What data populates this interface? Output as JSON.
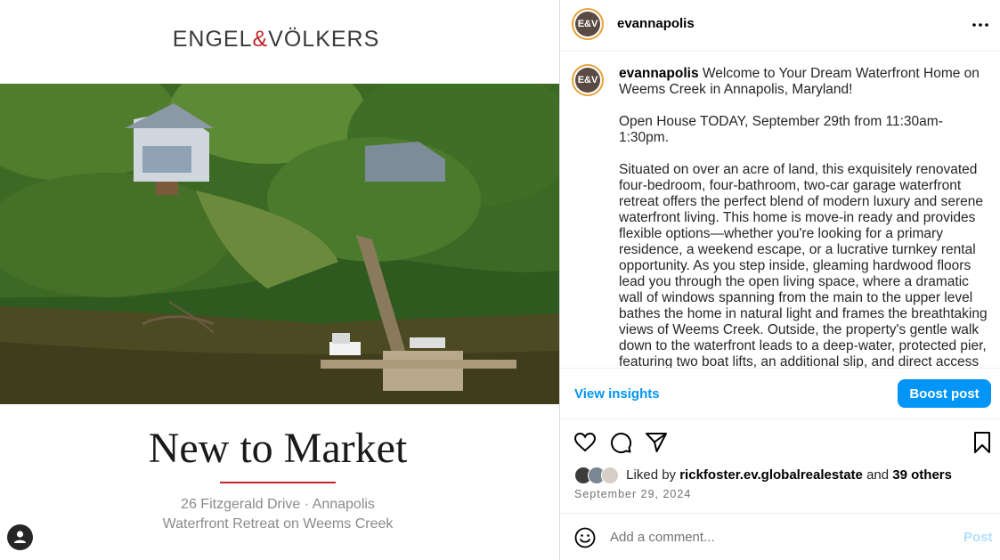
{
  "post_image": {
    "brand_part1": "ENGEL",
    "brand_amp": "&",
    "brand_part2": "VÖLKERS",
    "headline": "New to Market",
    "address_line1": "26 Fitzgerald Drive · Annapolis",
    "address_line2": "Waterfront Retreat on Weems Creek"
  },
  "header": {
    "avatar_text": "E&V",
    "username": "evannapolis"
  },
  "caption": {
    "username": "evannapolis",
    "intro": "Welcome to Your Dream Waterfront Home on Weems Creek in Annapolis, Maryland!",
    "open_house": "Open House TODAY, September 29th from 11:30am-1:30pm.",
    "body": "Situated on over an acre of land, this exquisitely renovated four-bedroom, four-bathroom, two-car garage waterfront retreat offers the perfect blend of modern luxury and serene waterfront living. This home is move-in ready and provides flexible options—whether you're looking for a primary residence, a weekend escape, or a lucrative turnkey rental opportunity. As you step inside, gleaming hardwood floors lead you through the open living space, where a dramatic wall of windows spanning from the main to the upper level bathes the home in natural light and frames the breathtaking views of Weems Creek. Outside, the property's gentle walk down to the waterfront leads to a deep-water, protected pier, featuring two boat lifts, an additional slip, and direct access to the calm, scenic waters of Weems Creek. Located just minutes from the"
  },
  "insights": {
    "view_label": "View insights",
    "boost_label": "Boost post"
  },
  "engagement": {
    "liked_prefix": "Liked by",
    "liked_user": "rickfoster.ev.globalrealestate",
    "liked_and": "and",
    "liked_others": "39 others",
    "date": "September 29, 2024"
  },
  "comment": {
    "placeholder": "Add a comment...",
    "post_label": "Post"
  },
  "colors": {
    "accent_blue": "#0095f6",
    "brand_red": "#c1272d",
    "avatar_ring": "#e4a33a"
  },
  "icons": [
    "more-options-icon",
    "heart-icon",
    "comment-icon",
    "share-icon",
    "bookmark-icon",
    "emoji-icon",
    "user-icon"
  ]
}
